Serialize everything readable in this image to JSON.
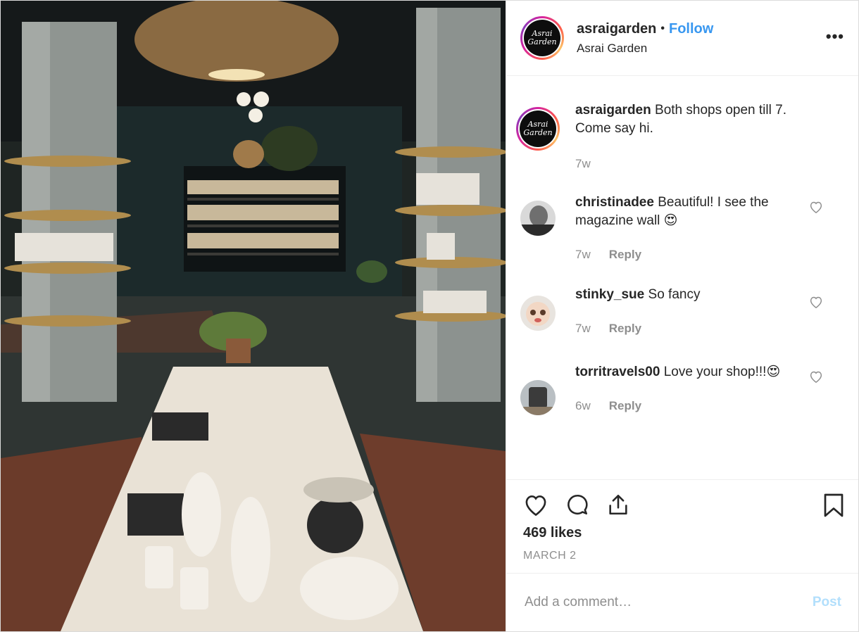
{
  "post": {
    "photo_alt": "store interior photo",
    "header": {
      "username": "asraigarden",
      "separator": "•",
      "follow_label": "Follow",
      "location": "Asrai Garden",
      "more_icon": "more-options-icon",
      "avatar_text": "Asrai Garden"
    },
    "caption": {
      "username": "asraigarden",
      "text": "Both shops open till 7. Come say hi.",
      "time": "7w"
    },
    "comments": [
      {
        "username": "christinadee",
        "text": "Beautiful! I see the magazine wall 😍",
        "time": "7w",
        "reply_label": "Reply"
      },
      {
        "username": "stinky_sue",
        "text": "So fancy",
        "time": "7w",
        "reply_label": "Reply"
      },
      {
        "username": "torritravels00",
        "text": "Love your shop!!!😍",
        "time": "6w",
        "reply_label": "Reply"
      }
    ],
    "actions": {
      "like_icon": "heart-icon",
      "comment_icon": "comment-icon",
      "share_icon": "share-icon",
      "save_icon": "bookmark-icon"
    },
    "likes": "469 likes",
    "date": "MARCH 2",
    "add_comment": {
      "placeholder": "Add a comment…",
      "value": "",
      "post_label": "Post"
    },
    "colors": {
      "link_blue": "#3897f0",
      "post_disabled": "#b2dffc",
      "muted": "#8e8e8e",
      "text": "#262626"
    }
  }
}
